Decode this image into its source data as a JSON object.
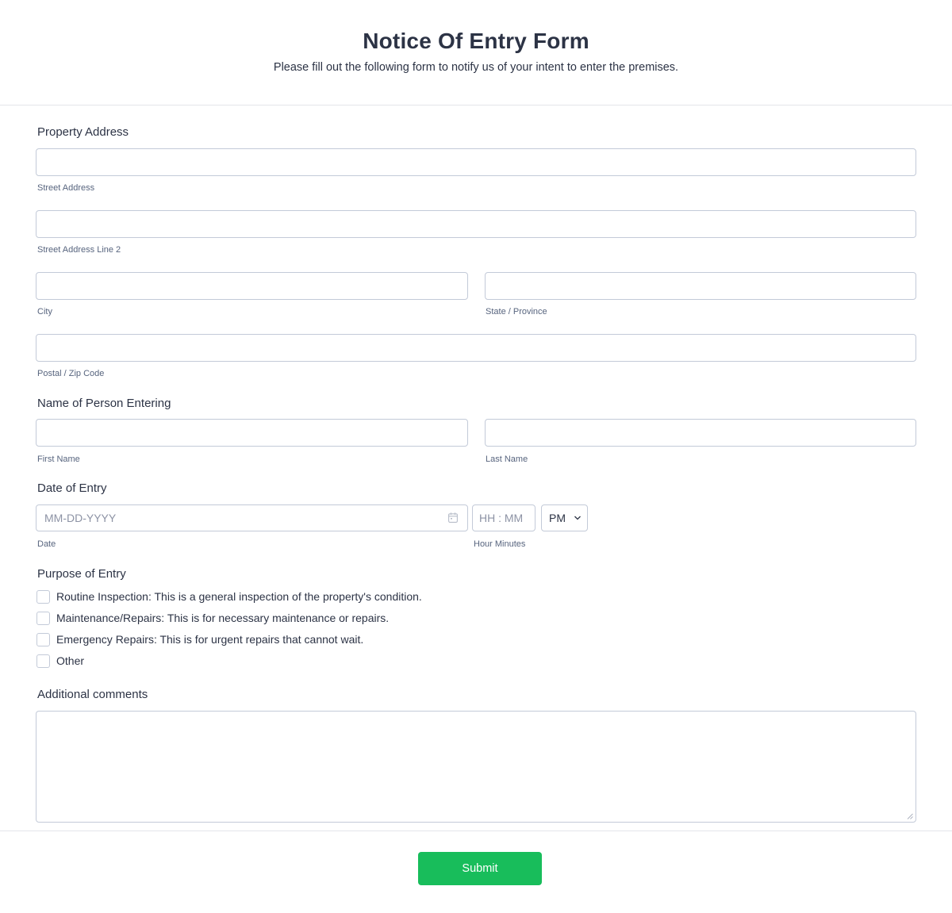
{
  "form": {
    "title": "Notice Of Entry Form",
    "subtitle": "Please fill out the following form to notify us of your intent to enter the premises."
  },
  "property_address": {
    "label": "Property Address",
    "street": {
      "value": "",
      "sublabel": "Street Address"
    },
    "street2": {
      "value": "",
      "sublabel": "Street Address Line 2"
    },
    "city": {
      "value": "",
      "sublabel": "City"
    },
    "state": {
      "value": "",
      "sublabel": "State / Province"
    },
    "postal": {
      "value": "",
      "sublabel": "Postal / Zip Code"
    }
  },
  "person_entering": {
    "label": "Name of Person Entering",
    "first": {
      "value": "",
      "sublabel": "First Name"
    },
    "last": {
      "value": "",
      "sublabel": "Last Name"
    }
  },
  "date_of_entry": {
    "label": "Date of Entry",
    "date": {
      "value": "",
      "placeholder": "MM-DD-YYYY",
      "sublabel": "Date"
    },
    "time": {
      "value": "",
      "placeholder": "HH : MM",
      "sublabel": "Hour Minutes"
    },
    "ampm": {
      "selected": "PM"
    },
    "icon": "calendar-icon"
  },
  "purpose": {
    "label": "Purpose of Entry",
    "options": [
      {
        "label": "Routine Inspection: This is a general inspection of the property's condition.",
        "checked": false
      },
      {
        "label": "Maintenance/Repairs: This is for necessary maintenance or repairs.",
        "checked": false
      },
      {
        "label": "Emergency Repairs: This is for urgent repairs that cannot wait.",
        "checked": false
      },
      {
        "label": "Other",
        "checked": false
      }
    ]
  },
  "comments": {
    "label": "Additional comments",
    "value": ""
  },
  "submit": {
    "label": "Submit",
    "color": "#18bd5b"
  },
  "colors": {
    "text": "#2c3345",
    "border": "#c3cad8",
    "sublabel": "#57647e",
    "accent": "#18bd5b"
  }
}
